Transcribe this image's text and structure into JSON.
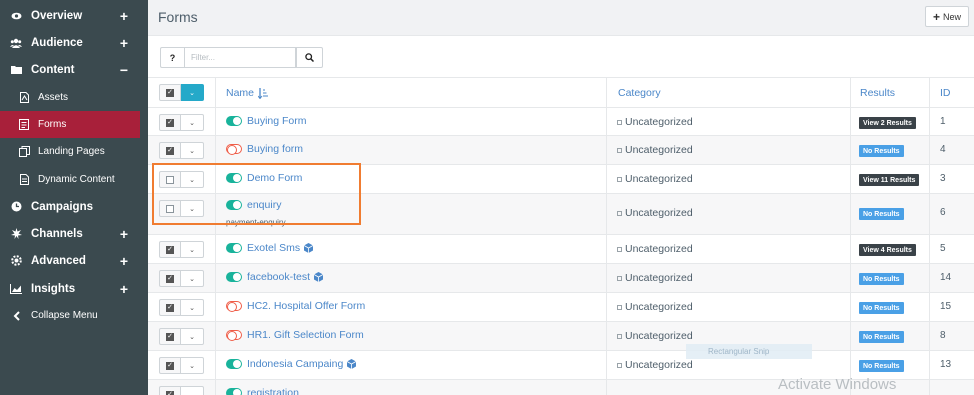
{
  "sidebar": {
    "items": [
      {
        "label": "Overview",
        "icon": "eye-icon",
        "expand": "+"
      },
      {
        "label": "Audience",
        "icon": "users-icon",
        "expand": "+"
      },
      {
        "label": "Content",
        "icon": "folder-icon",
        "expand": "−"
      },
      {
        "label": "Assets",
        "icon": "file-icon"
      },
      {
        "label": "Forms",
        "icon": "form-icon"
      },
      {
        "label": "Landing Pages",
        "icon": "pages-icon"
      },
      {
        "label": "Dynamic Content",
        "icon": "document-icon"
      },
      {
        "label": "Campaigns",
        "icon": "clock-icon"
      },
      {
        "label": "Channels",
        "icon": "puzzle-icon",
        "expand": "+"
      },
      {
        "label": "Advanced",
        "icon": "cog-icon",
        "expand": "+"
      },
      {
        "label": "Insights",
        "icon": "chart-icon",
        "expand": "+"
      },
      {
        "label": "Collapse Menu",
        "icon": "chevron-left-icon"
      }
    ]
  },
  "header": {
    "title": "Forms",
    "new_label": "New",
    "new_icon": "+"
  },
  "toolbar": {
    "help_icon": "?",
    "search_placeholder": "Filter..."
  },
  "table": {
    "columns": {
      "name": "Name",
      "category": "Category",
      "results": "Results",
      "id": "ID"
    },
    "rows": [
      {
        "name": "Buying Form",
        "category": "Uncategorized",
        "results": "View 2 Results",
        "id": "1",
        "active": true,
        "checked": true
      },
      {
        "name": "Buying form",
        "category": "Uncategorized",
        "results": "No Results",
        "id": "4",
        "active": false,
        "checked": true
      },
      {
        "name": "Demo Form",
        "category": "Uncategorized",
        "results": "View 11 Results",
        "id": "3",
        "active": true,
        "checked": false
      },
      {
        "name": "enquiry",
        "subtext": "payment-enquiry",
        "category": "Uncategorized",
        "results": "No Results",
        "id": "6",
        "active": true,
        "checked": false
      },
      {
        "name": "Exotel Sms",
        "category": "Uncategorized",
        "results": "View 4 Results",
        "id": "5",
        "active": true,
        "checked": true,
        "cube": true
      },
      {
        "name": "facebook-test",
        "category": "Uncategorized",
        "results": "No Results",
        "id": "14",
        "active": true,
        "checked": true,
        "cube": true
      },
      {
        "name": "HC2. Hospital Offer Form",
        "category": "Uncategorized",
        "results": "No Results",
        "id": "15",
        "active": false,
        "checked": true
      },
      {
        "name": "HR1. Gift Selection Form",
        "category": "Uncategorized",
        "results": "No Results",
        "id": "8",
        "active": false,
        "checked": true
      },
      {
        "name": "Indonesia Campaing",
        "category": "Uncategorized",
        "results": "No Results",
        "id": "13",
        "active": true,
        "checked": true,
        "cube": true
      },
      {
        "name": "registration",
        "category": "",
        "results": "",
        "id": "",
        "active": true,
        "checked": true
      }
    ]
  },
  "overlay": {
    "ghost_text": "Rectangular Snip",
    "watermark": "Activate Windows"
  },
  "colors": {
    "sidebar_bg": "#3b4a4f",
    "active_bg": "#a8203a",
    "link": "#4b87c9",
    "toggle_on": "#19b39b",
    "toggle_off": "#ef5d48",
    "highlight": "#f07c31"
  }
}
